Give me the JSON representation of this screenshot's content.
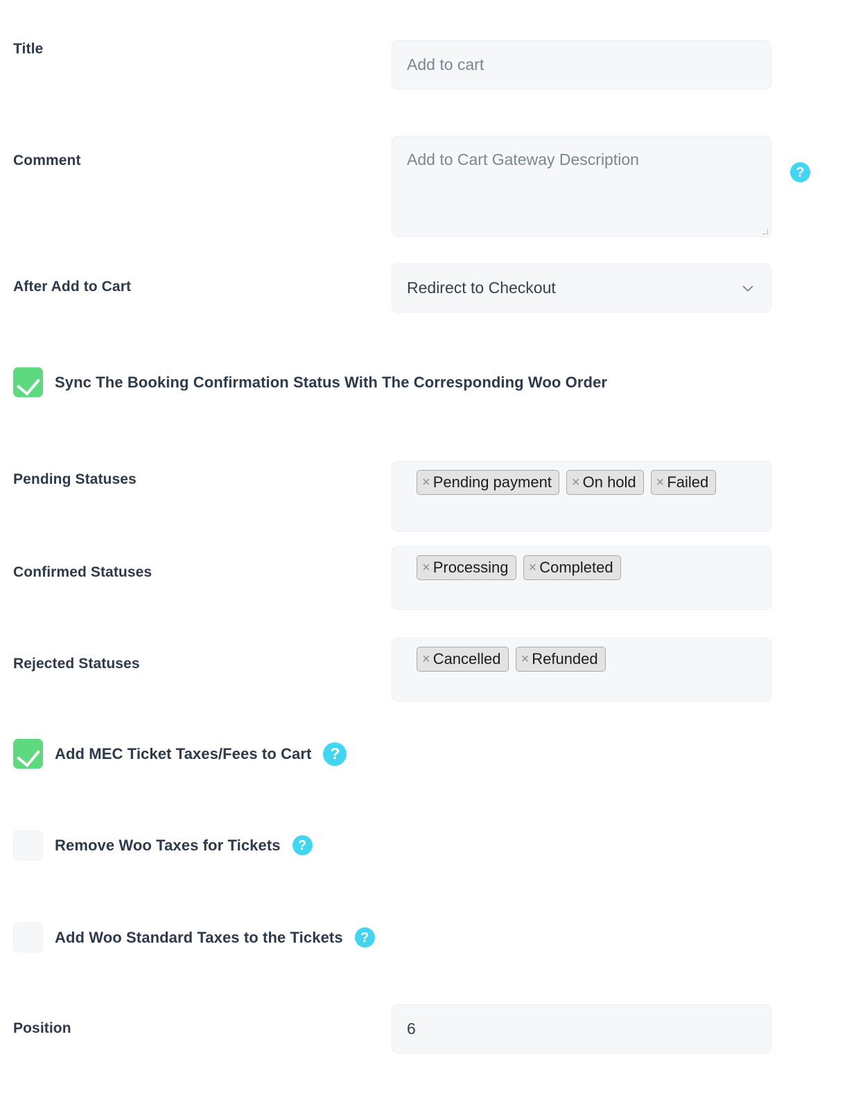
{
  "colors": {
    "accent_help": "#41d5f2",
    "checkbox_on": "#5ed97f",
    "field_bg": "#f6f7f9",
    "label_text": "#2d3a4b",
    "placeholder_text": "#7b8694",
    "tag_bg": "#e3e3e3",
    "tag_border": "#a9a9a9"
  },
  "fields": {
    "title": {
      "label": "Title",
      "placeholder": "Add to cart",
      "value": ""
    },
    "comment": {
      "label": "Comment",
      "placeholder": "Add to Cart Gateway Description",
      "value": "",
      "help_icon": "question-mark-icon"
    },
    "after_add_to_cart": {
      "label": "After Add to Cart",
      "selected": "Redirect to Checkout",
      "chevron_icon": "chevron-down-icon"
    },
    "position": {
      "label": "Position",
      "value": "6"
    }
  },
  "sync_checkbox": {
    "label": "Sync The Booking Confirmation Status With The Corresponding Woo Order",
    "checked": true
  },
  "status_groups": [
    {
      "label": "Pending Statuses",
      "tags": [
        "Pending payment",
        "On hold",
        "Failed"
      ]
    },
    {
      "label": "Confirmed Statuses",
      "tags": [
        "Processing",
        "Completed"
      ]
    },
    {
      "label": "Rejected Statuses",
      "tags": [
        "Cancelled",
        "Refunded"
      ]
    }
  ],
  "tax_checkboxes": [
    {
      "label": "Add MEC Ticket Taxes/Fees to Cart",
      "checked": true,
      "help_icon": "question-mark-icon"
    },
    {
      "label": "Remove Woo Taxes for Tickets",
      "checked": false,
      "help_icon": "question-mark-icon"
    },
    {
      "label": "Add Woo Standard Taxes to the Tickets",
      "checked": false,
      "help_icon": "question-mark-icon"
    }
  ],
  "icons": {
    "help": "?",
    "tag_remove": "×"
  }
}
